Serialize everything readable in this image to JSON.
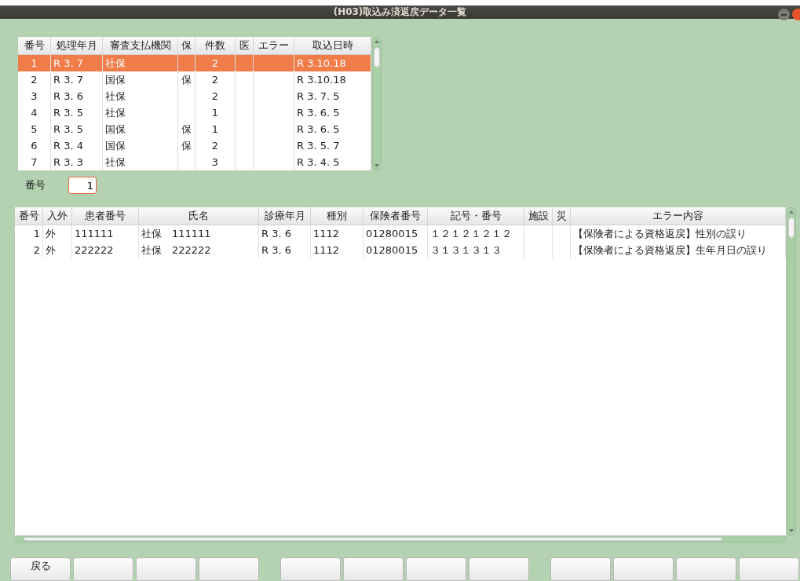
{
  "window": {
    "title": "(H03)取込み済返戻データ一覧"
  },
  "top_table": {
    "columns": [
      "番号",
      "処理年月",
      "審査支払機関",
      "保",
      "件数",
      "医",
      "エラー",
      "取込日時"
    ],
    "rows": [
      {
        "selected": true,
        "cells": [
          "1",
          "R 3. 7",
          "社保",
          "",
          "2",
          "",
          "",
          "R 3.10.18"
        ]
      },
      {
        "selected": false,
        "cells": [
          "2",
          "R 3. 7",
          "国保",
          "保",
          "2",
          "",
          "",
          "R 3.10.18"
        ]
      },
      {
        "selected": false,
        "cells": [
          "3",
          "R 3. 6",
          "社保",
          "",
          "2",
          "",
          "",
          "R 3. 7. 5"
        ]
      },
      {
        "selected": false,
        "cells": [
          "4",
          "R 3. 5",
          "社保",
          "",
          "1",
          "",
          "",
          "R 3. 6. 5"
        ]
      },
      {
        "selected": false,
        "cells": [
          "5",
          "R 3. 5",
          "国保",
          "保",
          "1",
          "",
          "",
          "R 3. 6. 5"
        ]
      },
      {
        "selected": false,
        "cells": [
          "6",
          "R 3. 4",
          "国保",
          "保",
          "2",
          "",
          "",
          "R 3. 5. 7"
        ]
      },
      {
        "selected": false,
        "cells": [
          "7",
          "R 3. 3",
          "社保",
          "",
          "3",
          "",
          "",
          "R 3. 4. 5"
        ]
      }
    ]
  },
  "number_field": {
    "label": "番号",
    "value": "1"
  },
  "error_table": {
    "columns": [
      "番号",
      "入外",
      "患者番号",
      "氏名",
      "診療年月",
      "種別",
      "保険者番号",
      "記号・番号",
      "施設",
      "災",
      "エラー内容"
    ],
    "rows": [
      {
        "selected": false,
        "cells": [
          "1",
          "外",
          "111111",
          "社保　111111",
          "R 3. 6",
          "1112",
          "01280015",
          "１２１２１２１２",
          "",
          "",
          "【保険者による資格返戻】性別の誤り"
        ]
      },
      {
        "selected": false,
        "cells": [
          "2",
          "外",
          "222222",
          "社保　222222",
          "R 3. 6",
          "1112",
          "01280015",
          "３１３１３１３",
          "",
          "",
          "【保険者による資格返戻】生年月日の誤り"
        ]
      }
    ]
  },
  "button_groups": [
    [
      {
        "kind": "text",
        "label": "戻る"
      },
      {
        "kind": "blank"
      },
      {
        "kind": "blank"
      },
      {
        "kind": "blank"
      }
    ],
    [
      {
        "kind": "blank"
      },
      {
        "kind": "blank"
      },
      {
        "kind": "blank"
      },
      {
        "kind": "blank"
      }
    ],
    [
      {
        "kind": "blank"
      },
      {
        "kind": "blank"
      },
      {
        "kind": "blank"
      },
      {
        "kind": "blank"
      }
    ]
  ]
}
